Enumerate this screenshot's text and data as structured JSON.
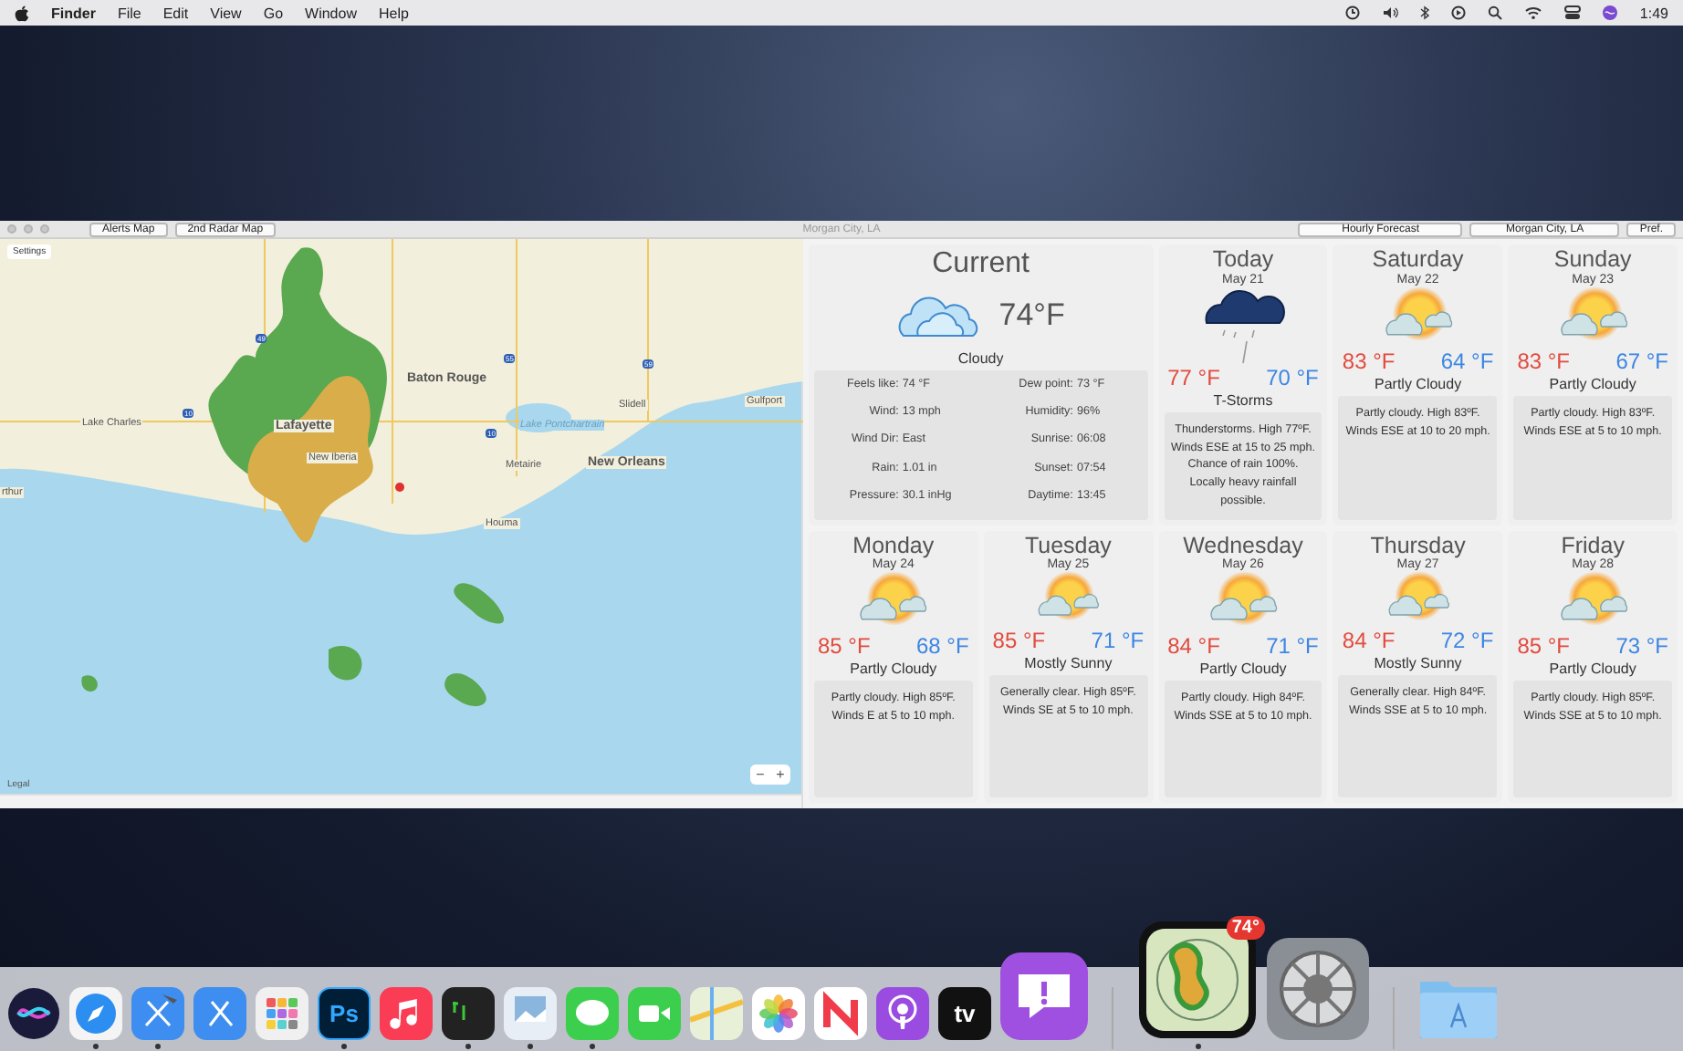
{
  "menubar": {
    "app": "Finder",
    "menus": [
      "File",
      "Edit",
      "View",
      "Go",
      "Window",
      "Help"
    ],
    "clock": "1:49"
  },
  "window": {
    "title": "Morgan City, LA",
    "left_buttons": [
      "Alerts Map",
      "2nd Radar Map"
    ],
    "hourly_button": "Hourly Forecast",
    "location_select": "Morgan City, LA",
    "pref_button": "Pref."
  },
  "map": {
    "settings_button": "Settings",
    "legal": "Legal",
    "zoom_out": "−",
    "zoom_in": "+",
    "labels": [
      {
        "text": "Baton Rouge",
        "kind": "city"
      },
      {
        "text": "Lake Charles",
        "kind": "town"
      },
      {
        "text": "Lafayette",
        "kind": "city"
      },
      {
        "text": "New Iberia",
        "kind": "town"
      },
      {
        "text": "Lake Pontchartrain",
        "kind": "water"
      },
      {
        "text": "Slidell",
        "kind": "town"
      },
      {
        "text": "Gulfport",
        "kind": "town"
      },
      {
        "text": "Metairie",
        "kind": "town"
      },
      {
        "text": "New Orleans",
        "kind": "city"
      },
      {
        "text": "Houma",
        "kind": "town"
      },
      {
        "text": "rthur",
        "kind": "town"
      },
      {
        "text": "49",
        "kind": "shield"
      },
      {
        "text": "55",
        "kind": "shield"
      },
      {
        "text": "59",
        "kind": "shield"
      },
      {
        "text": "10",
        "kind": "shield"
      },
      {
        "text": "10",
        "kind": "shield"
      }
    ]
  },
  "current": {
    "title": "Current",
    "temp": "74°F",
    "condition": "Cloudy",
    "kind": "cloudy",
    "details_left": [
      {
        "label": "Feels like:",
        "value": "74 °F"
      },
      {
        "label": "Wind:",
        "value": "13 mph"
      },
      {
        "label": "Wind Dir:",
        "value": "East"
      },
      {
        "label": "Rain:",
        "value": "1.01 in"
      },
      {
        "label": "Pressure:",
        "value": "30.1 inHg"
      }
    ],
    "details_right": [
      {
        "label": "Dew point:",
        "value": "73 °F"
      },
      {
        "label": "Humidity:",
        "value": "96%"
      },
      {
        "label": "Sunrise:",
        "value": "06:08"
      },
      {
        "label": "Sunset:",
        "value": "07:54"
      },
      {
        "label": "Daytime:",
        "value": "13:45"
      }
    ]
  },
  "forecast": [
    {
      "day": "Today",
      "date": "May 21",
      "kind": "storm",
      "high": "77 °F",
      "low": "70 °F",
      "condition": "T-Storms",
      "text": "Thunderstorms. High 77ºF. Winds ESE at 15 to 25 mph. Chance of rain 100%.  Locally heavy rainfall possible."
    },
    {
      "day": "Saturday",
      "date": "May 22",
      "kind": "partly",
      "high": "83 °F",
      "low": "64 °F",
      "condition": "Partly Cloudy",
      "text": "Partly cloudy. High 83ºF. Winds ESE at 10 to 20 mph."
    },
    {
      "day": "Sunday",
      "date": "May 23",
      "kind": "partly",
      "high": "83 °F",
      "low": "67 °F",
      "condition": "Partly Cloudy",
      "text": "Partly cloudy. High 83ºF. Winds ESE at 5 to 10 mph."
    },
    {
      "day": "Monday",
      "date": "May 24",
      "kind": "partly",
      "high": "85 °F",
      "low": "68 °F",
      "condition": "Partly Cloudy",
      "text": "Partly cloudy. High 85ºF. Winds E at 5 to 10 mph."
    },
    {
      "day": "Tuesday",
      "date": "May 25",
      "kind": "mostly",
      "high": "85 °F",
      "low": "71 °F",
      "condition": "Mostly Sunny",
      "text": "Generally clear. High 85ºF. Winds SE at 5 to 10 mph."
    },
    {
      "day": "Wednesday",
      "date": "May 26",
      "kind": "partly",
      "high": "84 °F",
      "low": "71 °F",
      "condition": "Partly Cloudy",
      "text": "Partly cloudy. High 84ºF. Winds SSE at 5 to 10 mph."
    },
    {
      "day": "Thursday",
      "date": "May 27",
      "kind": "mostly",
      "high": "84 °F",
      "low": "72 °F",
      "condition": "Mostly Sunny",
      "text": "Generally clear. High 84ºF. Winds SSE at 5 to 10 mph."
    },
    {
      "day": "Friday",
      "date": "May 28",
      "kind": "partly",
      "high": "85 °F",
      "low": "73 °F",
      "condition": "Partly Cloudy",
      "text": "Partly cloudy. High 85ºF. Winds SSE at 5 to 10 mph."
    }
  ],
  "dock": [
    {
      "kind": "siri",
      "running": false
    },
    {
      "kind": "safari",
      "running": true
    },
    {
      "kind": "xcode",
      "running": true
    },
    {
      "kind": "appstore-dev",
      "running": false
    },
    {
      "kind": "launchpad",
      "running": false
    },
    {
      "kind": "photoshop",
      "label": "Ps",
      "running": true
    },
    {
      "kind": "music",
      "running": false
    },
    {
      "kind": "terminal",
      "running": true
    },
    {
      "kind": "preview",
      "running": true
    },
    {
      "kind": "messages",
      "running": true
    },
    {
      "kind": "facetime",
      "running": false
    },
    {
      "kind": "maps",
      "running": false
    },
    {
      "kind": "photos",
      "running": false
    },
    {
      "kind": "news",
      "running": false
    },
    {
      "kind": "podcasts",
      "running": false
    },
    {
      "kind": "tv",
      "label": "tv",
      "running": false
    },
    {
      "kind": "feedback",
      "running": false
    },
    {
      "kind": "divider"
    },
    {
      "kind": "radar",
      "badge": "74°",
      "running": true
    },
    {
      "kind": "settings",
      "running": false
    },
    {
      "kind": "divider"
    },
    {
      "kind": "folder",
      "running": false
    }
  ]
}
